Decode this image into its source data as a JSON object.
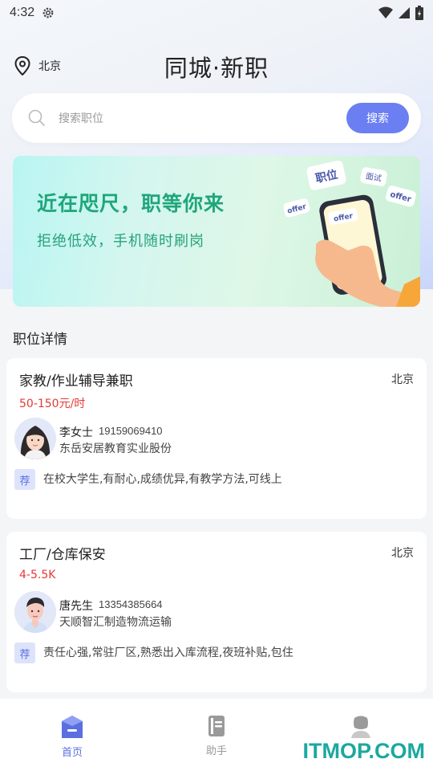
{
  "status_bar": {
    "time": "4:32"
  },
  "header": {
    "location": "北京",
    "title": "同城·新职"
  },
  "search": {
    "placeholder": "搜索职位",
    "button_label": "搜索"
  },
  "banner": {
    "headline": "近在咫尺，职等你来",
    "subtitle": "拒绝低效，手机随时刷岗",
    "stickers": [
      "职位",
      "面试",
      "offer",
      "offer",
      "offer"
    ]
  },
  "section_title": "职位详情",
  "jobs": [
    {
      "title": "家教/作业辅导兼职",
      "city": "北京",
      "salary": "50-150元/时",
      "contact_name": "李女士",
      "phone": "19159069410",
      "company": "东岳安居教育实业股份",
      "tag": "荐",
      "description": "在校大学生,有耐心,成绩优异,有教学方法,可线上"
    },
    {
      "title": "工厂/仓库保安",
      "city": "北京",
      "salary": "4-5.5K",
      "contact_name": "唐先生",
      "phone": "13354385664",
      "company": "天顺智汇制造物流运输",
      "tag": "荐",
      "description": "责任心强,常驻厂区,熟悉出入库流程,夜班补贴,包住"
    }
  ],
  "tabs": [
    {
      "label": "首页",
      "icon": "home-icon",
      "active": true
    },
    {
      "label": "助手",
      "icon": "book-icon",
      "active": false
    },
    {
      "label": "",
      "icon": "profile-icon",
      "active": false
    }
  ],
  "watermark": "ITMOP.COM",
  "colors": {
    "accent": "#6b7ff2",
    "salary": "#e53935",
    "banner_text": "#1fa67a"
  }
}
